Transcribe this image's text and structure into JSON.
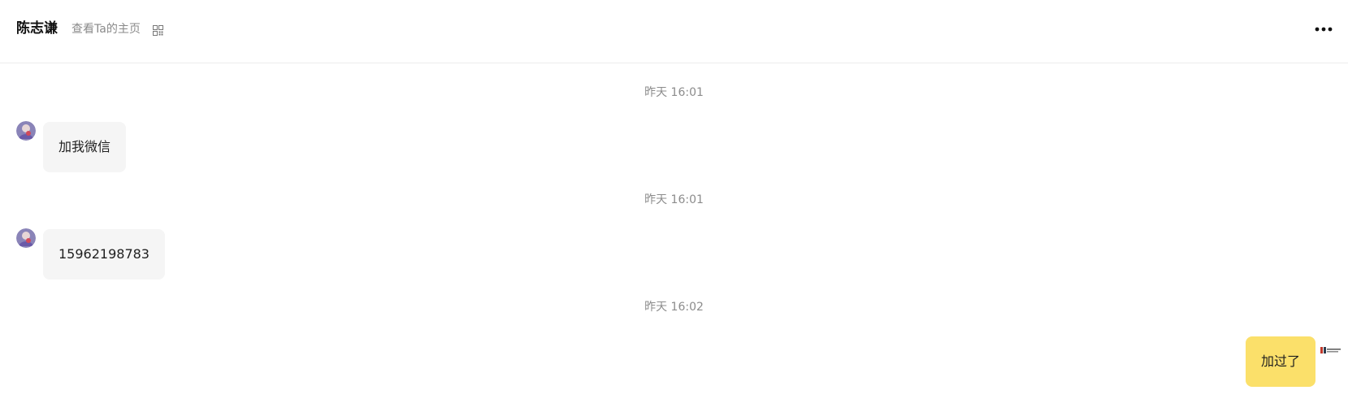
{
  "header": {
    "contact_name": "陈志谦",
    "profile_link": "查看Ta的主页",
    "qr_icon": "qr-code-icon",
    "more_icon": "more-horizontal-icon"
  },
  "messages": [
    {
      "timestamp": "昨天 16:01",
      "direction": "incoming",
      "text": "加我微信"
    },
    {
      "timestamp": "昨天 16:01",
      "direction": "incoming",
      "text": "15962198783"
    },
    {
      "timestamp": "昨天 16:02",
      "direction": "outgoing",
      "text": "加过了"
    }
  ],
  "colors": {
    "incoming_bubble": "#f5f5f5",
    "outgoing_bubble": "#fbe06a",
    "timestamp_text": "#8c8c8c"
  }
}
